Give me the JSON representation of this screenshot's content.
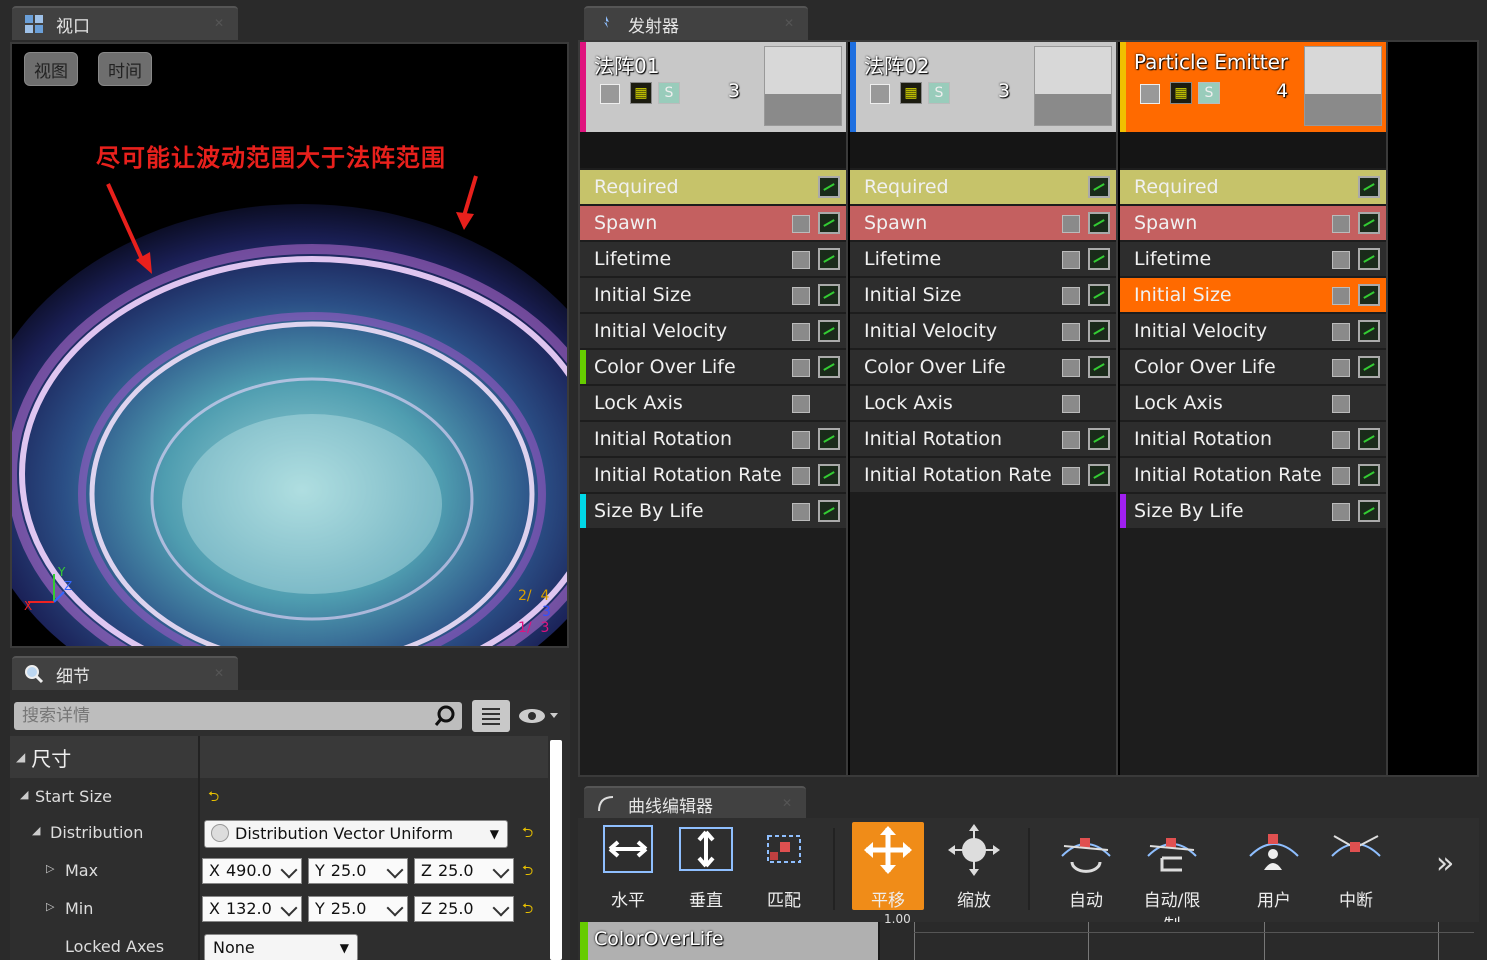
{
  "viewport_tab": {
    "title": "视口"
  },
  "viewport": {
    "buttons": [
      "视图",
      "时间"
    ],
    "annotation": "尽可能让波动范围大于法阵范围",
    "stats": [
      "2/",
      "4",
      "3",
      "1/",
      "3"
    ]
  },
  "emitters_tab": {
    "title": "发射器"
  },
  "emitters": [
    {
      "name": "法阵01",
      "count": "3",
      "accent": "#e0127e",
      "head_bg": "#c8c8c8",
      "modules": [
        "Required",
        "Spawn",
        "Lifetime",
        "Initial Size",
        "Initial Velocity",
        "Color Over Life",
        "Lock Axis",
        "Initial Rotation",
        "Initial Rotation Rate",
        "Size By Life"
      ]
    },
    {
      "name": "法阵02",
      "count": "3",
      "accent": "#1e6fe0",
      "head_bg": "#c8c8c8",
      "modules": [
        "Required",
        "Spawn",
        "Lifetime",
        "Initial Size",
        "Initial Velocity",
        "Color Over Life",
        "Lock Axis",
        "Initial Rotation",
        "Initial Rotation Rate"
      ]
    },
    {
      "name": "Particle Emitter",
      "count": "4",
      "accent": "#f0c000",
      "head_bg": "#ff6a00",
      "modules": [
        "Required",
        "Spawn",
        "Lifetime",
        "Initial Size",
        "Initial Velocity",
        "Color Over Life",
        "Lock Axis",
        "Initial Rotation",
        "Initial Rotation Rate",
        "Size By Life"
      ]
    }
  ],
  "details_tab": {
    "title": "细节"
  },
  "details": {
    "search_placeholder": "搜索详情",
    "section": "尺寸",
    "start_size": "Start Size",
    "distribution_label": "Distribution",
    "distribution_value": "Distribution Vector Uniform",
    "max_label": "Max",
    "max": {
      "x": "490.0",
      "y": "25.0",
      "z": "25.0"
    },
    "min_label": "Min",
    "min": {
      "x": "132.0",
      "y": "25.0",
      "z": "25.0"
    },
    "locked_axes_label": "Locked Axes",
    "locked_axes_value": "None",
    "axis_x": "X",
    "axis_y": "Y",
    "axis_z": "Z"
  },
  "curve_tab": {
    "title": "曲线编辑器"
  },
  "curve_toolbar": [
    "水平",
    "垂直",
    "匹配",
    "平移",
    "缩放",
    "自动",
    "自动/限制",
    "用户",
    "中断"
  ],
  "curve": {
    "track_label": "ColorOverLife",
    "tick_label": "1.00"
  }
}
